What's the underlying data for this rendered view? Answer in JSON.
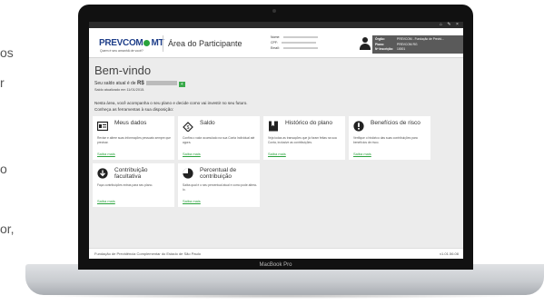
{
  "side_text": [
    "os",
    "r",
    "o",
    "or,"
  ],
  "laptop": {
    "model": "MacBook Pro"
  },
  "header": {
    "logo": "PREVCOM",
    "logo_suffix": "MT",
    "logo_tagline": "Quem é seu amanhã de você?",
    "area_title": "Área do Participante",
    "user_labels": [
      "Nome:",
      "CPF:",
      "Email:"
    ],
    "org": [
      {
        "label": "Órgão:",
        "value": "PREVCOM - Fundação de Previd..."
      },
      {
        "label": "Plano:",
        "value": "PREVCOM RG"
      },
      {
        "label": "Nº Inscrição:",
        "value": "10001"
      }
    ]
  },
  "main": {
    "title": "Bem-vindo",
    "balance_label": "Seu saldo atual é de",
    "balance_currency": "R$",
    "balance_date": "Saldo atualizado em 11/01/2015.",
    "intro_1": "Nesta área, você acompanha o seu plano e decide como vai investir no seu futuro.",
    "intro_2": "Conheça as ferramentas à sua disposição:"
  },
  "cards": [
    {
      "title": "Meus dados",
      "desc": "Revise e altere suas informações pessoais sempre que precisar.",
      "link": "Saiba mais",
      "icon": "id-card-icon"
    },
    {
      "title": "Saldo",
      "desc": "Confira o valor acumulado na sua Conta Individual até agora.",
      "link": "Saiba mais",
      "icon": "money-icon"
    },
    {
      "title": "Histórico do plano",
      "desc": "Veja todas as transações que já foram feitas na sua Conta, inclusive as contribuições.",
      "link": "Saiba mais",
      "icon": "bookmark-icon"
    },
    {
      "title": "Benefícios de risco",
      "desc": "Verifique o histórico das suas contribuições para benefícios de risco.",
      "link": "Saiba mais",
      "icon": "alert-icon"
    },
    {
      "title": "Contribuição facultativa",
      "desc": "Faça contribuições extras para seu plano.",
      "link": "Saiba mais",
      "icon": "download-icon"
    },
    {
      "title": "Percentual de contribuição",
      "desc": "Saiba qual é o seu percentual atual e como pode alterá-lo.",
      "link": "Saiba mais",
      "icon": "pie-icon"
    }
  ],
  "footer": {
    "text": "Fundação de Previdência Complementar do Estado de São Paulo",
    "right": "v1.01.56.08"
  },
  "colors": {
    "brand_blue": "#1f3f8a",
    "accent_green": "#2aa33d",
    "org_box": "#5a5a5a"
  }
}
